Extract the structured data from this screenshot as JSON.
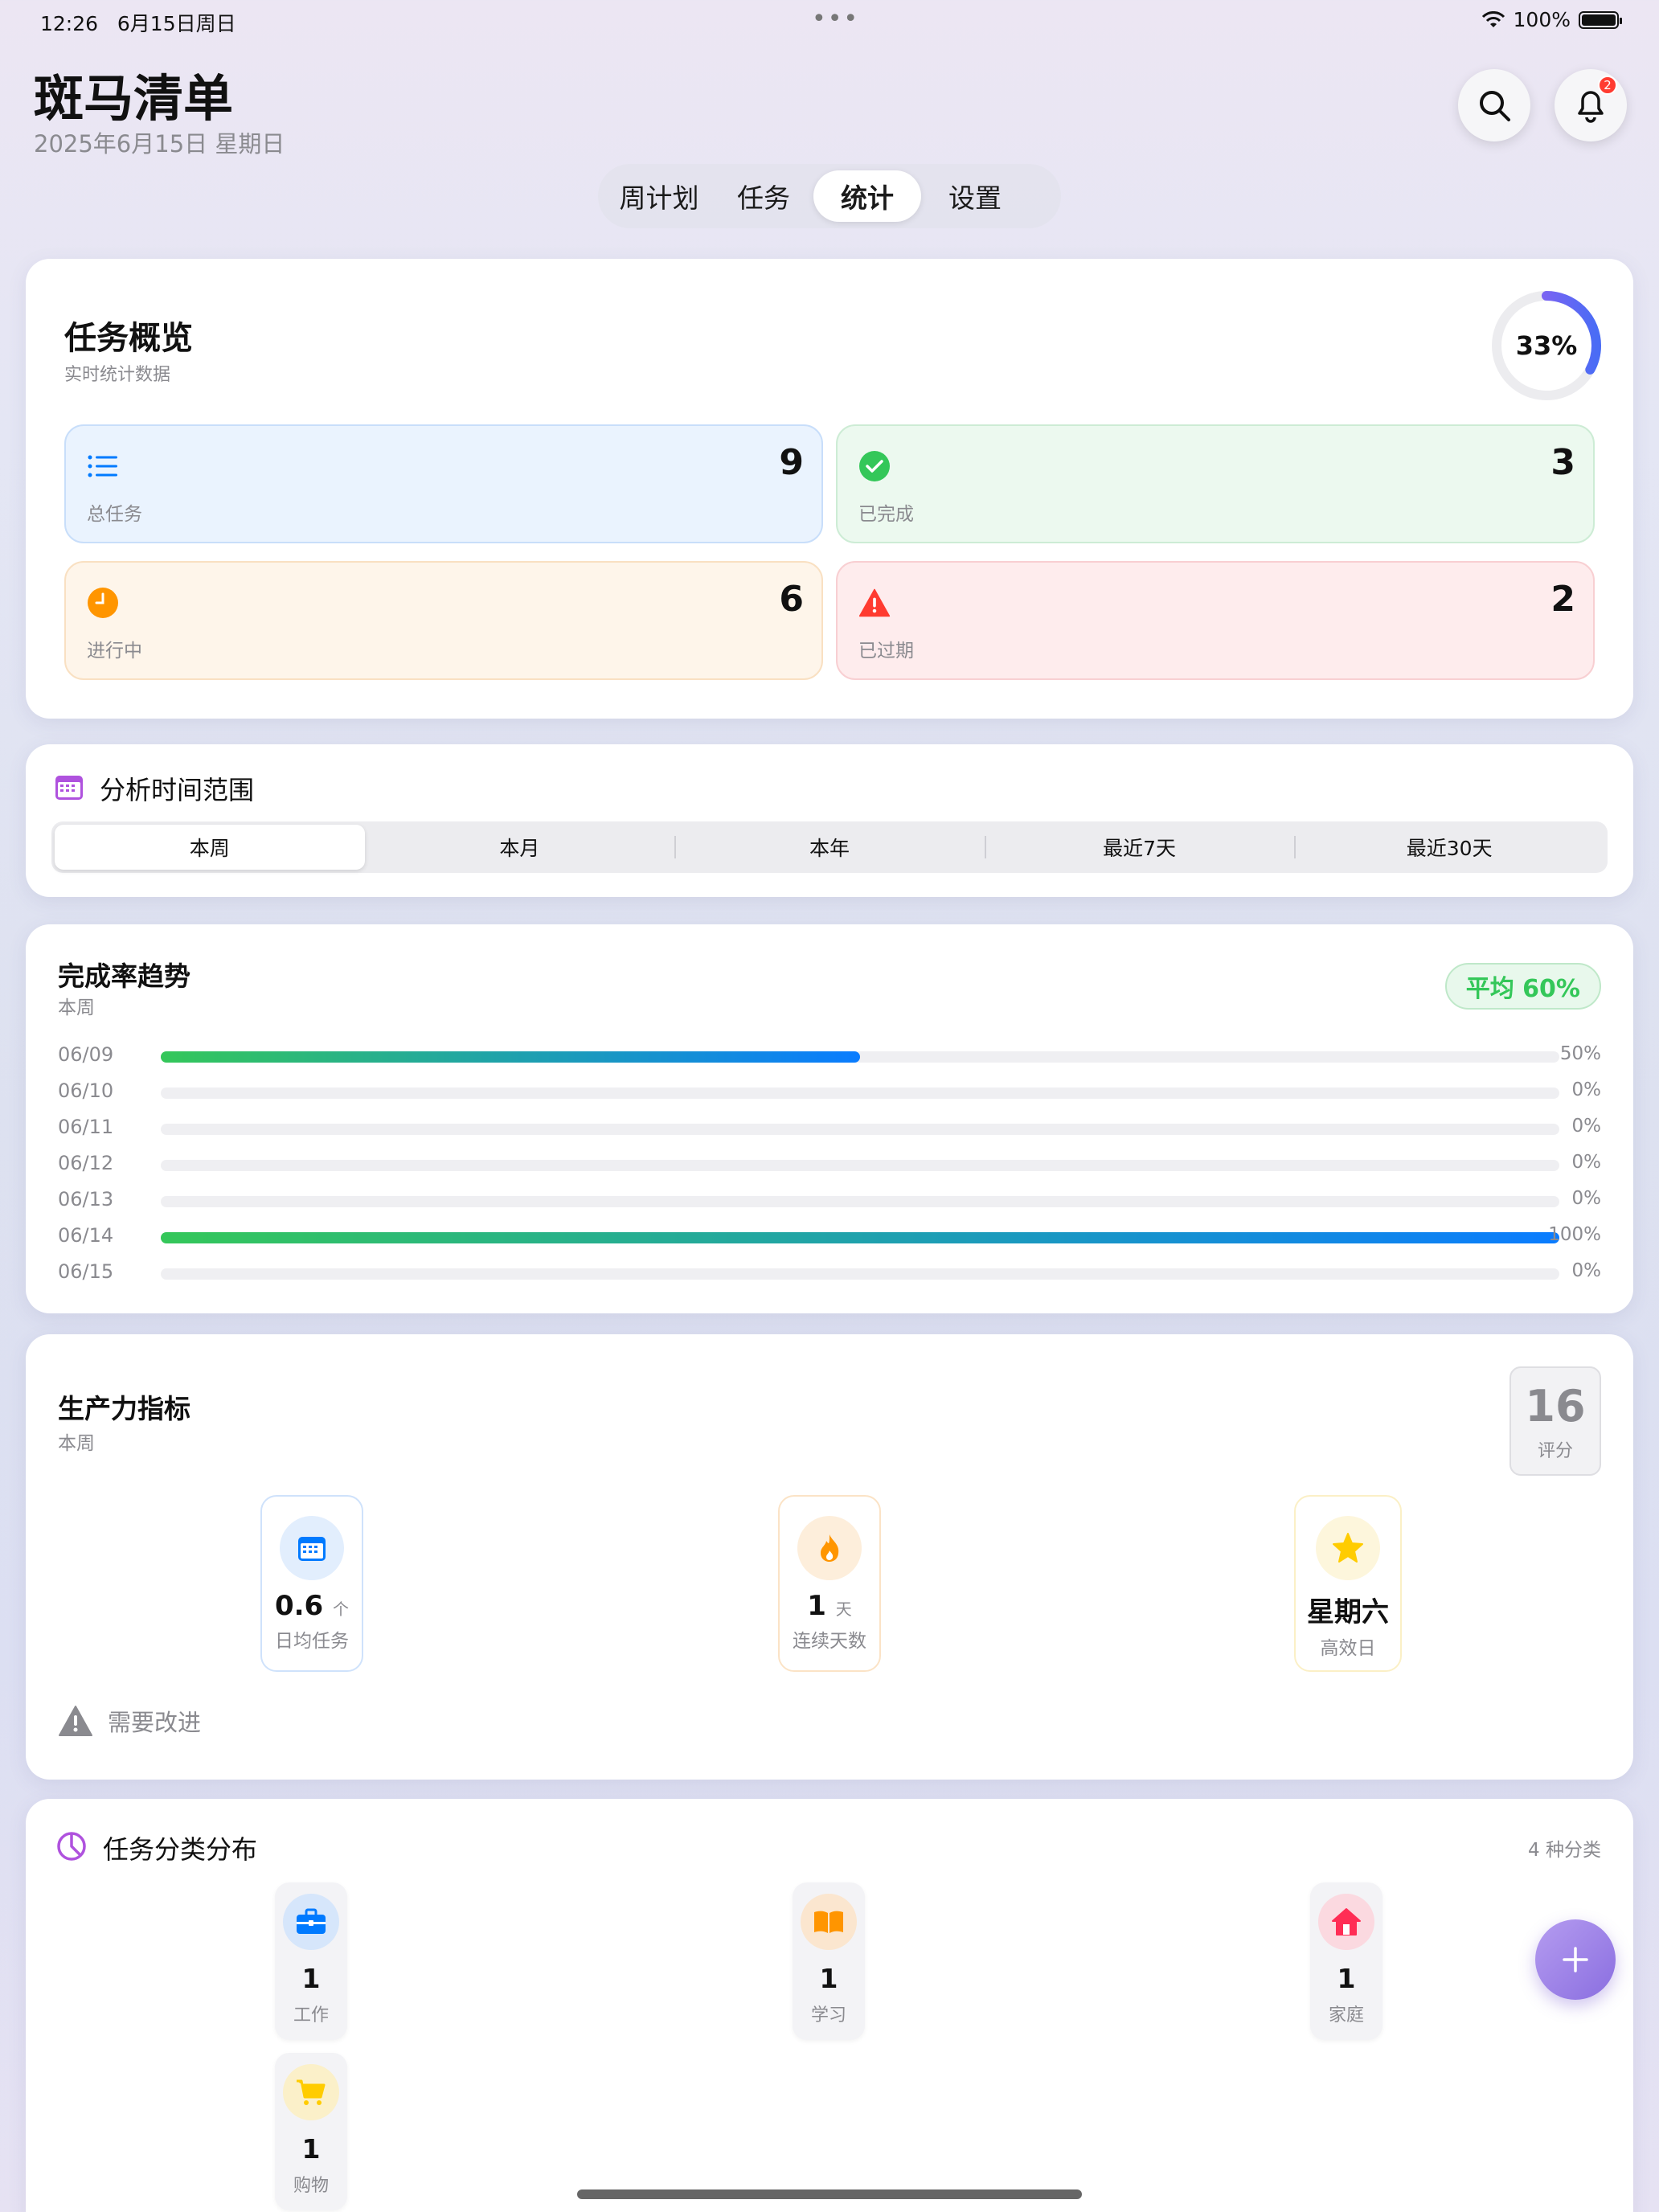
{
  "status": {
    "time": "12:26",
    "date": "6月15日周日",
    "battery": "100%"
  },
  "header": {
    "title": "斑马清单",
    "date": "2025年6月15日 星期日",
    "notification_count": "2"
  },
  "tabs": [
    {
      "label": "周计划",
      "active": false
    },
    {
      "label": "任务",
      "active": false
    },
    {
      "label": "统计",
      "active": true
    },
    {
      "label": "设置",
      "active": false
    }
  ],
  "overview": {
    "title": "任务概览",
    "subtitle": "实时统计数据",
    "completion_percent": 33,
    "completion_label": "33%",
    "stats": [
      {
        "label": "总任务",
        "value": "9",
        "icon": "list-icon",
        "color": "#007aff"
      },
      {
        "label": "已完成",
        "value": "3",
        "icon": "check-circle-icon",
        "color": "#34c759"
      },
      {
        "label": "进行中",
        "value": "6",
        "icon": "clock-icon",
        "color": "#ff9500"
      },
      {
        "label": "已过期",
        "value": "2",
        "icon": "warning-icon",
        "color": "#ff3b30"
      }
    ]
  },
  "range": {
    "title": "分析时间范围",
    "options": [
      "本周",
      "本月",
      "本年",
      "最近7天",
      "最近30天"
    ],
    "selected": "本周"
  },
  "trend": {
    "title": "完成率趋势",
    "subtitle": "本周",
    "average": "平均 60%",
    "rows": [
      {
        "date": "06/09",
        "percent": 50,
        "label": "50%"
      },
      {
        "date": "06/10",
        "percent": 0,
        "label": "0%"
      },
      {
        "date": "06/11",
        "percent": 0,
        "label": "0%"
      },
      {
        "date": "06/12",
        "percent": 0,
        "label": "0%"
      },
      {
        "date": "06/13",
        "percent": 0,
        "label": "0%"
      },
      {
        "date": "06/14",
        "percent": 100,
        "label": "100%"
      },
      {
        "date": "06/15",
        "percent": 0,
        "label": "0%"
      }
    ]
  },
  "productivity": {
    "title": "生产力指标",
    "subtitle": "本周",
    "score": "16",
    "score_label": "评分",
    "metrics": [
      {
        "value": "0.6",
        "unit": "个",
        "label": "日均任务",
        "icon": "calendar-icon"
      },
      {
        "value": "1",
        "unit": "天",
        "label": "连续天数",
        "icon": "flame-icon"
      },
      {
        "value": "星期六",
        "unit": "",
        "label": "高效日",
        "icon": "star-icon"
      }
    ],
    "note": "需要改进"
  },
  "categories": {
    "title": "任务分类分布",
    "count_label": "4 种分类",
    "items": [
      {
        "label": "工作",
        "count": "1",
        "icon": "briefcase-icon"
      },
      {
        "label": "学习",
        "count": "1",
        "icon": "book-icon"
      },
      {
        "label": "家庭",
        "count": "1",
        "icon": "house-icon"
      },
      {
        "label": "购物",
        "count": "1",
        "icon": "cart-icon"
      }
    ]
  }
}
